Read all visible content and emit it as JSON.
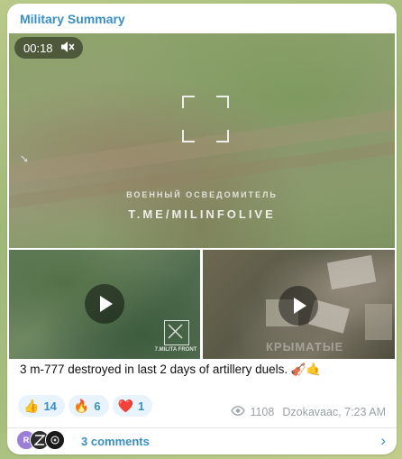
{
  "post": {
    "channel_name": "Military Summary",
    "video_duration": "00:18",
    "watermark_line1": "ВОЕННЫЙ ОСВЕДОМИТЕЛЬ",
    "watermark_line2": "T.ME/MILINFOLIVE",
    "thumb_left_caption": "7.MILITA FRONT",
    "thumb_right_watermark": "КРЫМАТЫЕ",
    "text": "3 m-777 destroyed in last 2 days of artillery duels. 🎻🤙"
  },
  "reactions": [
    {
      "emoji": "👍",
      "count": "14"
    },
    {
      "emoji": "🔥",
      "count": "6"
    },
    {
      "emoji": "❤️",
      "count": "1"
    }
  ],
  "meta": {
    "views": "1108",
    "author_time": "Dzokavaac, 7:23 AM"
  },
  "comments": {
    "avatar_initial": "R",
    "label": "3 comments"
  },
  "icons": {
    "mute": "muted-speaker-icon",
    "play": "play-icon",
    "views": "eye-icon",
    "chevron": "chevron-right-icon"
  },
  "colors": {
    "accent": "#3a8fc2",
    "reaction_bg": "#e9f3fb",
    "meta_text": "#9aa1a8"
  }
}
